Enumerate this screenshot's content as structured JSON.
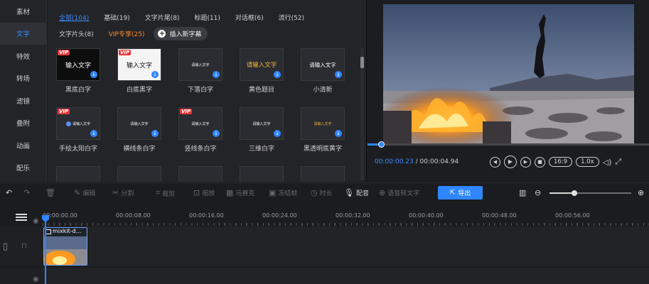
{
  "nav": {
    "items": [
      {
        "label": "素材",
        "active": false
      },
      {
        "label": "文字",
        "active": true
      },
      {
        "label": "特效",
        "active": false
      },
      {
        "label": "转场",
        "active": false
      },
      {
        "label": "滤镜",
        "active": false
      },
      {
        "label": "叠附",
        "active": false
      },
      {
        "label": "动画",
        "active": false
      },
      {
        "label": "配乐",
        "active": false
      }
    ]
  },
  "library": {
    "tabs_row1": [
      {
        "label": "全部(104)",
        "active": true
      },
      {
        "label": "基础(19)"
      },
      {
        "label": "文字片尾(8)"
      },
      {
        "label": "标题(11)"
      },
      {
        "label": "对话框(6)"
      },
      {
        "label": "流行(52)"
      }
    ],
    "tabs_row2": [
      {
        "label": "文字片头(8)"
      },
      {
        "label": "VIP专享(25)",
        "vip": true
      }
    ],
    "insert_button": "插入新字幕",
    "vip_badge": "VIP",
    "cards": [
      {
        "label": "黑底白字",
        "thumb_text": "输入文字",
        "style": "black",
        "vip": true
      },
      {
        "label": "白底黑字",
        "thumb_text": "输入文字",
        "style": "white",
        "vip": true
      },
      {
        "label": "下落白字",
        "thumb_text": "请输入文字",
        "style": "small",
        "vip": false
      },
      {
        "label": "黄色题目",
        "thumb_text": "请输入文字",
        "style": "yellow",
        "vip": false
      },
      {
        "label": "小清新",
        "thumb_text": "请输入文字",
        "style": "light",
        "vip": false
      },
      {
        "label": "手绘太阳白字",
        "thumb_text": "请输入文字",
        "style": "small-globe",
        "vip": true
      },
      {
        "label": "横线条白字",
        "thumb_text": "请输入文字",
        "style": "small",
        "vip": false
      },
      {
        "label": "竖线条白字",
        "thumb_text": "请输入文字",
        "style": "small",
        "vip": true
      },
      {
        "label": "三维白字",
        "thumb_text": "请输入文字",
        "style": "small",
        "vip": false
      },
      {
        "label": "黑透明底黄字",
        "thumb_text": "请输入文字",
        "style": "small-yellow",
        "vip": false
      }
    ]
  },
  "preview": {
    "progress_fraction": 0.048,
    "current_time": "00:00:00.23",
    "separator": " / ",
    "total_time": "00:00:04.94",
    "aspect": "16:9",
    "speed": "1.0x"
  },
  "toolbar": {
    "edit": "编辑",
    "split": "分割",
    "crop": "裁剪",
    "zoom": "缩放",
    "mosaic": "马赛克",
    "freeze": "冻结帧",
    "duration": "时长",
    "dub": "配音",
    "speech_to_text": "语音转文字",
    "export": "导出",
    "zoom_level_fraction": 0.3
  },
  "timeline": {
    "ruler": [
      "00:00:00.00",
      "00:00:08.00",
      "00:00:16.00",
      "00:00:24.00",
      "00:00:32.00",
      "00:00:40.00",
      "00:00:48.00",
      "00:00:56.00"
    ],
    "clip_label": "mixkit-d..."
  },
  "colors": {
    "accent": "#2f86ff",
    "vip": "#ff8a2a",
    "vip_badge": "#e8383a"
  }
}
